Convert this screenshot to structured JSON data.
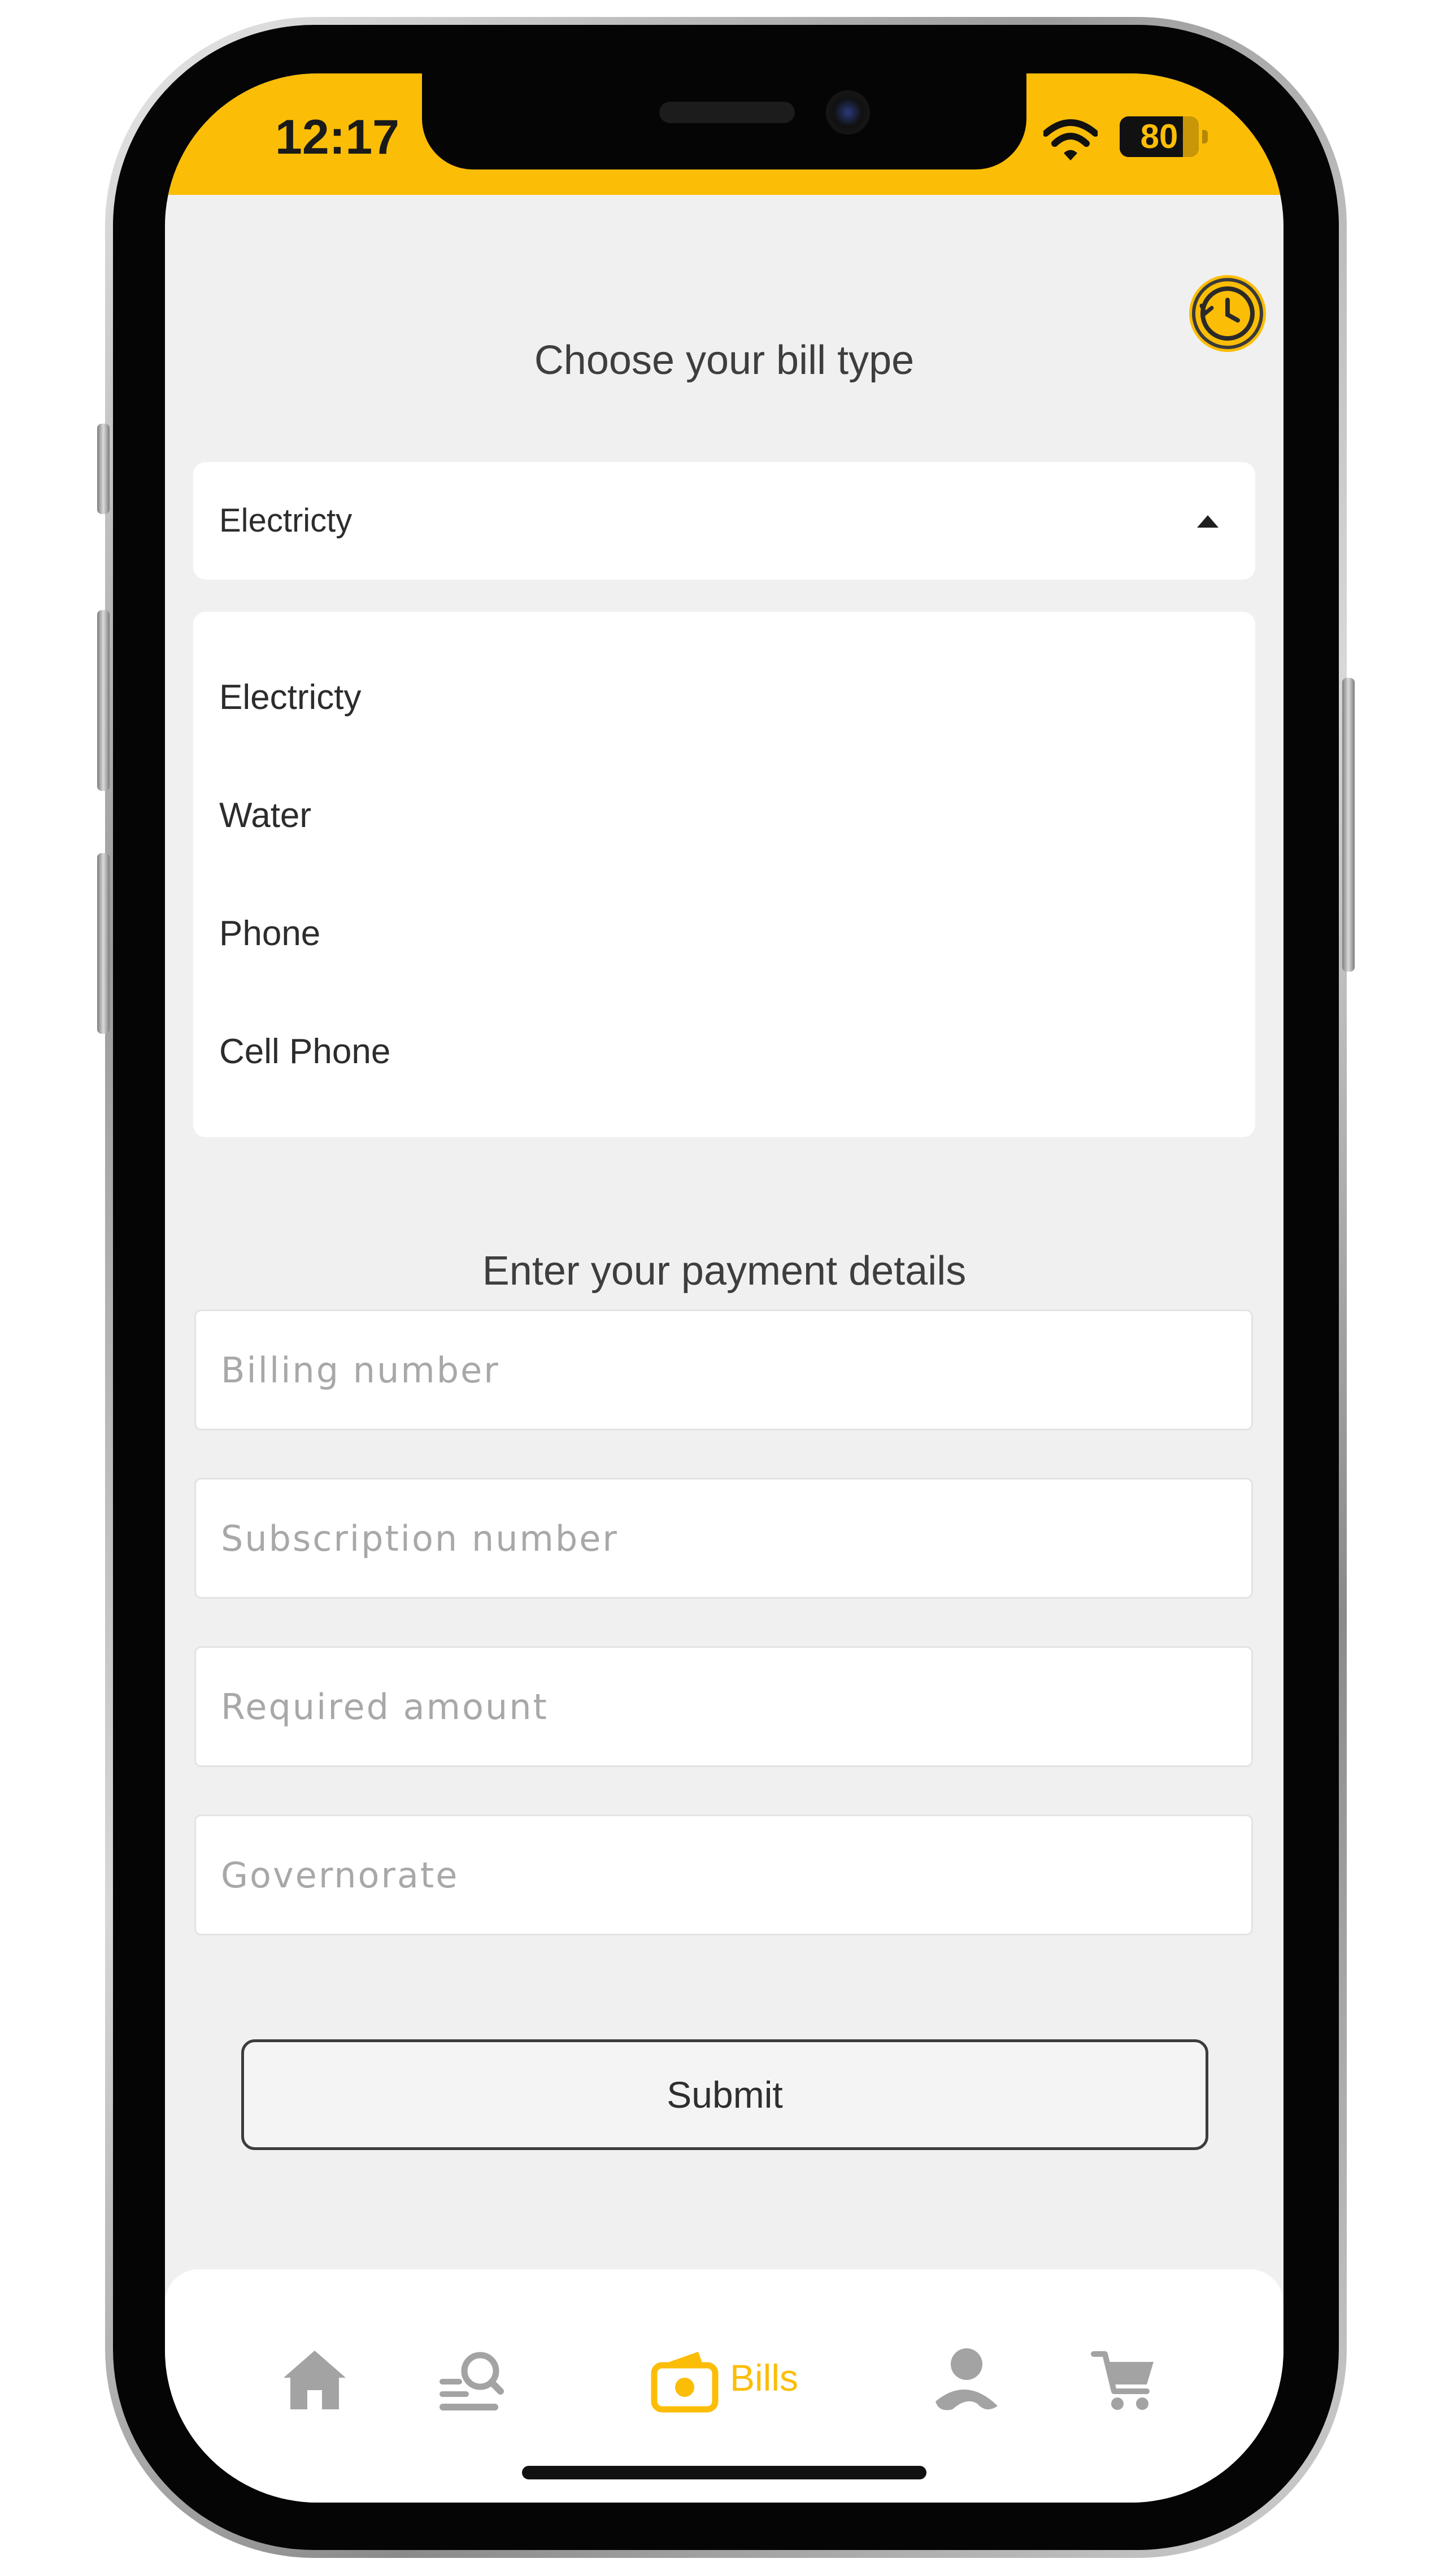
{
  "status_bar": {
    "time": "12:17",
    "battery_level": "80",
    "battery_fraction": 0.8,
    "accent_color": "#fcbd06"
  },
  "bill_type": {
    "title": "Choose your bill type",
    "history_icon": "history-clock-icon",
    "selected_value": "Electricty",
    "options": [
      "Electricty",
      "Water",
      "Phone",
      "Cell Phone"
    ]
  },
  "payment": {
    "title": "Enter your payment details",
    "billing_number_placeholder": "Billing number",
    "subscription_number_placeholder": "Subscription number",
    "required_amount_placeholder": "Required amount",
    "governorate_placeholder": "Governorate",
    "submit_label": "Submit"
  },
  "bottom_nav": {
    "items": [
      {
        "icon": "home-icon",
        "active": false
      },
      {
        "icon": "search-list-icon",
        "active": false
      },
      {
        "icon": "wallet-icon",
        "label": "Bills",
        "active": true
      },
      {
        "icon": "profile-icon",
        "active": false
      },
      {
        "icon": "cart-icon",
        "active": false
      }
    ],
    "active_color": "#fcbd06",
    "inactive_color": "#a3a3a3"
  }
}
